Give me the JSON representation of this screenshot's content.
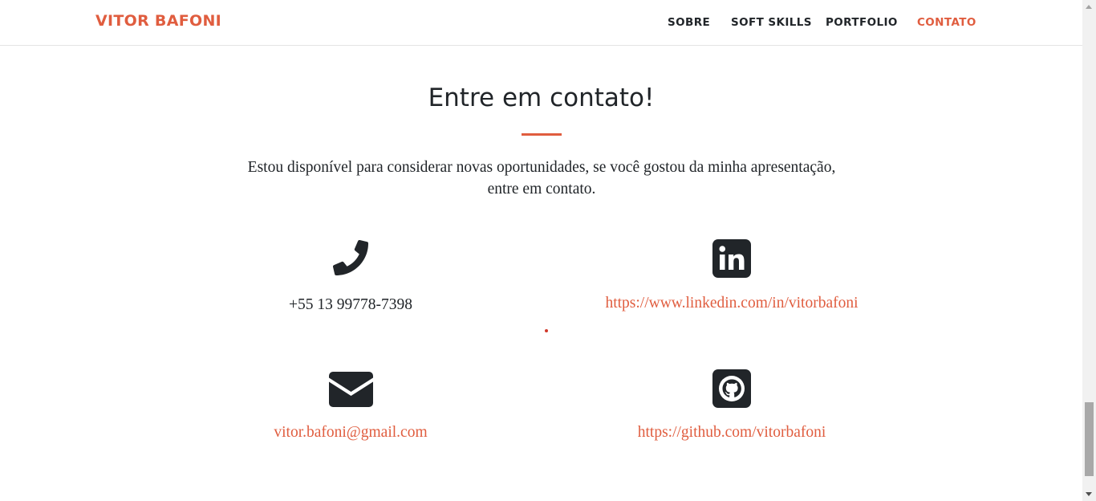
{
  "navbar": {
    "brand": "VITOR BAFONI",
    "links": [
      {
        "label": "SOBRE",
        "active": false
      },
      {
        "label": "SOFT SKILLS",
        "active": false
      },
      {
        "label": "PORTFOLIO",
        "active": false
      },
      {
        "label": "CONTATO",
        "active": true
      }
    ]
  },
  "contact": {
    "title": "Entre em contato!",
    "intro": "Estou disponível para considerar novas oportunidades, se você gostou da minha apresentação, entre em contato.",
    "items": [
      {
        "icon": "phone-icon",
        "text": "+55 13 99778-7398",
        "is_link": false
      },
      {
        "icon": "linkedin-icon",
        "text": "https://www.linkedin.com/in/vitorbafoni",
        "is_link": true
      },
      {
        "icon": "envelope-icon",
        "text": "vitor.bafoni@gmail.com",
        "is_link": true
      },
      {
        "icon": "github-icon",
        "text": "https://github.com/vitorbafoni",
        "is_link": true
      }
    ]
  },
  "colors": {
    "accent": "#e05d3f",
    "text": "#212529",
    "icon": "#212529",
    "background": "#ffffff"
  }
}
